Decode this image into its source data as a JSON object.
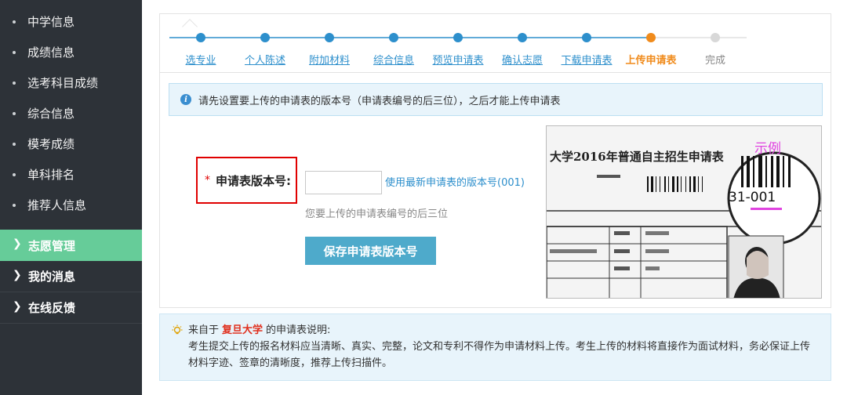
{
  "sidebar": {
    "sub_items": [
      {
        "label": "中学信息"
      },
      {
        "label": "成绩信息"
      },
      {
        "label": "选考科目成绩"
      },
      {
        "label": "综合信息"
      },
      {
        "label": "模考成绩"
      },
      {
        "label": "单科排名"
      },
      {
        "label": "推荐人信息"
      }
    ],
    "main_items": [
      {
        "label": "志愿管理",
        "active": true
      },
      {
        "label": "我的消息",
        "active": false
      },
      {
        "label": "在线反馈",
        "active": false
      }
    ]
  },
  "steps": [
    {
      "label": "选专业",
      "state": "done"
    },
    {
      "label": "个人陈述",
      "state": "done"
    },
    {
      "label": "附加材料",
      "state": "done"
    },
    {
      "label": "综合信息",
      "state": "done"
    },
    {
      "label": "预览申请表",
      "state": "done"
    },
    {
      "label": "确认志愿",
      "state": "done"
    },
    {
      "label": "下载申请表",
      "state": "done"
    },
    {
      "label": "上传申请表",
      "state": "current"
    },
    {
      "label": "完成",
      "state": "todo"
    }
  ],
  "colors": {
    "step_done": "#2d8fcc",
    "step_current": "#f08b1c",
    "step_todo": "#d8d8d8",
    "sidebar_active": "#66cc99"
  },
  "info": {
    "icon": "info-icon",
    "text": "请先设置要上传的申请表的版本号（申请表编号的后三位），之后才能上传申请表"
  },
  "form": {
    "required_mark": "*",
    "label": "申请表版本号:",
    "input_value": "",
    "use_latest_link": "使用最新申请表的版本号(001)",
    "hint": "您要上传的申请表编号的后三位",
    "save_button": "保存申请表版本号"
  },
  "example": {
    "title": "大学2016年普通自主招生申请表",
    "tag": "示例",
    "number": "31-001"
  },
  "note": {
    "icon": "lightbulb-icon",
    "prefix": "来自于",
    "school": "复旦大学",
    "suffix": "的申请表说明:",
    "body": "考生提交上传的报名材料应当清晰、真实、完整，论文和专利不得作为申请材料上传。考生上传的材料将直接作为面试材料，务必保证上传材料字迹、签章的清晰度，推荐上传扫描件。"
  }
}
